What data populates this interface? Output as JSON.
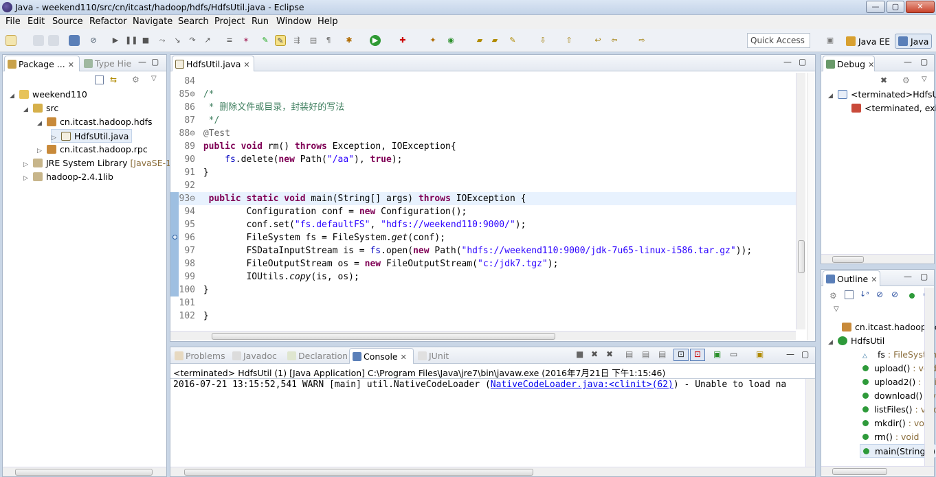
{
  "window": {
    "title": "Java - weekend110/src/cn/itcast/hadoop/hdfs/HdfsUtil.java - Eclipse",
    "min": "—",
    "max": "▢",
    "close": "✕"
  },
  "menu": [
    "File",
    "Edit",
    "Source",
    "Refactor",
    "Navigate",
    "Search",
    "Project",
    "Run",
    "Window",
    "Help"
  ],
  "toolbar": {
    "quick_access": "Quick Access"
  },
  "perspectives": [
    {
      "label": "Java EE",
      "active": false
    },
    {
      "label": "Java",
      "active": true
    }
  ],
  "left_panel": {
    "tabs": [
      {
        "label": "Package ...",
        "close": "✕"
      },
      {
        "label": "Type Hie"
      }
    ],
    "tree": [
      {
        "label": "weekend110",
        "arrow": "◢"
      },
      {
        "label": "src",
        "arrow": "◢"
      },
      {
        "label": "cn.itcast.hadoop.hdfs",
        "arrow": "◢"
      },
      {
        "label": "HdfsUtil.java",
        "arrow": "▷"
      },
      {
        "label": "cn.itcast.hadoop.rpc",
        "arrow": "▷"
      },
      {
        "label": "JRE System Library",
        "suffix": "[JavaSE-1.",
        "arrow": "▷"
      },
      {
        "label": "hadoop-2.4.1lib",
        "arrow": "▷"
      }
    ]
  },
  "editor": {
    "tab": "HdfsUtil.java",
    "lines": [
      {
        "n": "84",
        "t": ""
      },
      {
        "n": "85⊖",
        "t": "/*"
      },
      {
        "n": "86",
        "t": " * 删除文件或目录，封装好的写法"
      },
      {
        "n": "87",
        "t": " */"
      },
      {
        "n": "88⊖",
        "t": "@Test"
      },
      {
        "n": "89",
        "t": "public void rm() throws Exception, IOException{"
      },
      {
        "n": "90",
        "t": "    fs.delete(new Path(\"/aa\"), true);"
      },
      {
        "n": "91",
        "t": "}"
      },
      {
        "n": "92",
        "t": ""
      },
      {
        "n": "93⊖",
        "t": " public static void main(String[] args) throws IOException {"
      },
      {
        "n": "94",
        "t": "        Configuration conf = new Configuration();"
      },
      {
        "n": "95",
        "t": "        conf.set(\"fs.defaultFS\", \"hdfs://weekend110:9000/\");"
      },
      {
        "n": "96",
        "t": "        FileSystem fs = FileSystem.get(conf);"
      },
      {
        "n": "97",
        "t": "        FSDataInputStream is = fs.open(new Path(\"hdfs://weekend110:9000/jdk-7u65-linux-i586.tar.gz\"));"
      },
      {
        "n": "98",
        "t": "        FileOutputStream os = new FileOutputStream(\"c:/jdk7.tgz\");"
      },
      {
        "n": "99",
        "t": "        IOUtils.copy(is, os);"
      },
      {
        "n": "100",
        "t": "}"
      },
      {
        "n": "101",
        "t": ""
      },
      {
        "n": "102",
        "t": "}"
      }
    ]
  },
  "console": {
    "tabs": [
      "Problems",
      "Javadoc",
      "Declaration",
      "Console",
      "JUnit"
    ],
    "header": "<terminated> HdfsUtil (1) [Java Application] C:\\Program Files\\Java\\jre7\\bin\\javaw.exe (2016年7月21日 下午1:15:46)",
    "log_prefix": "2016-07-21 13:15:52,541 WARN  [main] util.NativeCodeLoader (",
    "log_link": "NativeCodeLoader.java:<clinit>(62)",
    "log_suffix": ") - Unable to load na"
  },
  "debug": {
    "tab": "Debug",
    "rows": [
      "<terminated>HdfsUt",
      "<terminated, exit"
    ]
  },
  "outline": {
    "tab": "Outline",
    "rows": [
      {
        "label": "cn.itcast.hadoop.hc",
        "type": ""
      },
      {
        "label": "HdfsUtil",
        "type": ""
      },
      {
        "label": "fs",
        "type": " : FileSystem"
      },
      {
        "label": "upload()",
        "type": " : void"
      },
      {
        "label": "upload2()",
        "type": " : voi"
      },
      {
        "label": "download()",
        "type": " : v"
      },
      {
        "label": "listFiles()",
        "type": " : void"
      },
      {
        "label": "mkdir()",
        "type": " : void"
      },
      {
        "label": "rm()",
        "type": " : void"
      },
      {
        "label": "main(String[])",
        "type": ""
      }
    ]
  },
  "colors": {
    "keyword": "#7f0055",
    "string": "#2a00ff",
    "comment": "#3f7f5f",
    "field": "#0000c0"
  }
}
